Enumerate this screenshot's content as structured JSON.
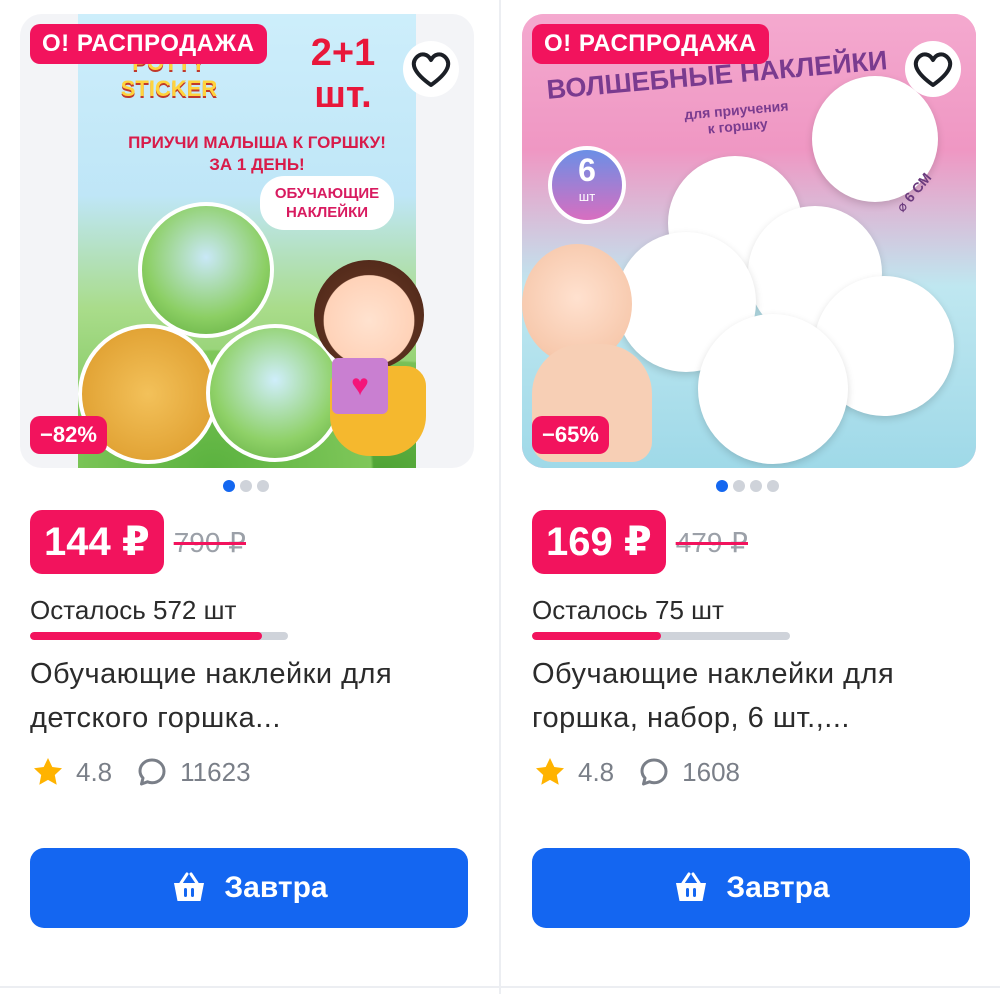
{
  "colors": {
    "accent": "#f2135d",
    "primary": "#1466f1",
    "muted": "#9ba0a8"
  },
  "products": [
    {
      "sale_badge": "О! РАСПРОДАЖА",
      "discount": "−82%",
      "art": {
        "brand": "POTTY STICKER",
        "promo": "2+1 шт.",
        "headline": "ПРИУЧИ МАЛЫША К ГОРШКУ! ЗА 1 ДЕНЬ!",
        "sub": "ОБУЧАЮЩИЕ НАКЛЕЙКИ"
      },
      "price": "144 ₽",
      "old_price": "790 ₽",
      "stock": "Осталось 572 шт",
      "stock_level": 0.9,
      "title_line1": "Обучающие наклейки для",
      "title_line2": "детского горшка...",
      "rating": "4.8",
      "reviews": "11623",
      "button": "Завтра",
      "dots": 3
    },
    {
      "sale_badge": "О! РАСПРОДАЖА",
      "discount": "−65%",
      "art": {
        "headline": "ВОЛШЕБНЫЕ НАКЛЕЙКИ",
        "sub": "для приучения к горшку",
        "count": "6",
        "count_unit": "шт",
        "size": "⌀ 6 СМ"
      },
      "price": "169 ₽",
      "old_price": "479 ₽",
      "stock": "Осталось 75 шт",
      "stock_level": 0.5,
      "title_line1": "Обучающие наклейки для",
      "title_line2": "горшка, набор, 6 шт.,...",
      "rating": "4.8",
      "reviews": "1608",
      "button": "Завтра",
      "dots": 4
    }
  ]
}
